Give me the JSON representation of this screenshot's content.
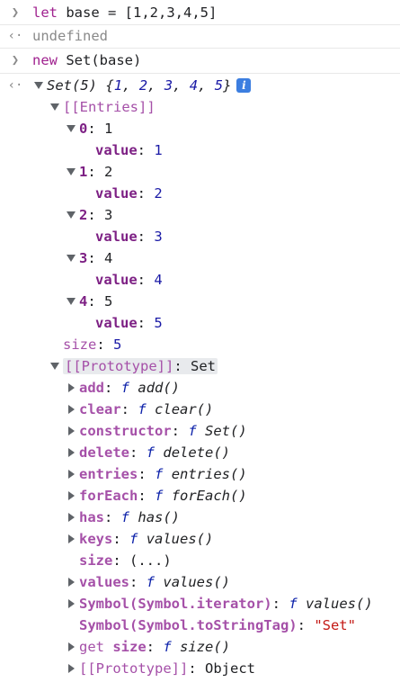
{
  "input1": {
    "keyword": "let",
    "rest": "base = [1,2,3,4,5]"
  },
  "output1": "undefined",
  "input2": {
    "keyword": "new",
    "rest": "Set(base)"
  },
  "result": {
    "summary_name": "Set(5)",
    "summary_open": "{",
    "summary_items": [
      "1",
      "2",
      "3",
      "4",
      "5"
    ],
    "summary_close": "}",
    "info_icon": "i",
    "entries_label": "[[Entries]]",
    "entries": [
      {
        "index": "0",
        "value_label": "value",
        "value": "1",
        "preview": "1"
      },
      {
        "index": "1",
        "value_label": "value",
        "value": "2",
        "preview": "2"
      },
      {
        "index": "2",
        "value_label": "value",
        "value": "3",
        "preview": "3"
      },
      {
        "index": "3",
        "value_label": "value",
        "value": "4",
        "preview": "4"
      },
      {
        "index": "4",
        "value_label": "value",
        "value": "5",
        "preview": "5"
      }
    ],
    "size_label": "size",
    "size_value": "5",
    "prototype_label": "[[Prototype]]",
    "prototype_value": "Set",
    "proto_members": [
      {
        "key": "add",
        "f": "f",
        "sig": "add()"
      },
      {
        "key": "clear",
        "f": "f",
        "sig": "clear()"
      },
      {
        "key": "constructor",
        "f": "f",
        "sig": "Set()"
      },
      {
        "key": "delete",
        "f": "f",
        "sig": "delete()"
      },
      {
        "key": "entries",
        "f": "f",
        "sig": "entries()"
      },
      {
        "key": "forEach",
        "f": "f",
        "sig": "forEach()"
      },
      {
        "key": "has",
        "f": "f",
        "sig": "has()"
      },
      {
        "key": "keys",
        "f": "f",
        "sig": "values()"
      }
    ],
    "size_getter_label": "size",
    "size_getter_value": "(...)",
    "values_member": {
      "key": "values",
      "f": "f",
      "sig": "values()"
    },
    "iterator_member": {
      "key": "Symbol(Symbol.iterator)",
      "f": "f",
      "sig": "values()"
    },
    "tostringtag_member": {
      "key": "Symbol(Symbol.toStringTag)",
      "value": "\"Set\""
    },
    "get_size_member": {
      "prefix": "get",
      "key": "size",
      "f": "f",
      "sig": "size()"
    },
    "inner_prototype_label": "[[Prototype]]",
    "inner_prototype_value": "Object"
  },
  "colors": {
    "keyword": "#a0228f",
    "number": "#1a1aa6",
    "key": "#7d2084",
    "string": "#c41a16",
    "info_badge": "#3c7ee0"
  },
  "icons": {
    "input_prompt": "chevron-right-icon",
    "output_prompt": "return-arrow-icon",
    "expanded": "triangle-down-icon",
    "collapsed": "triangle-right-icon"
  }
}
